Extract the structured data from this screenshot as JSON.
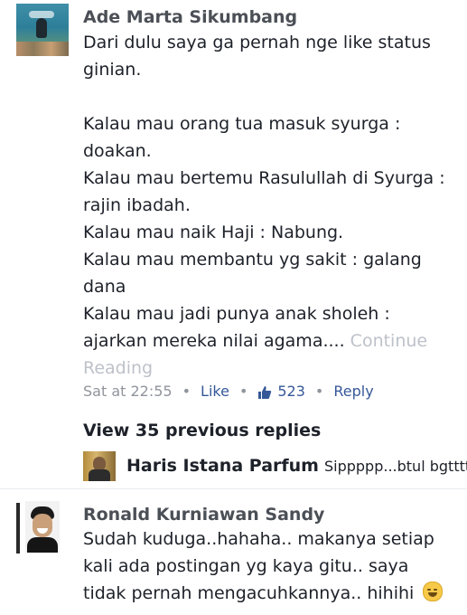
{
  "comment1": {
    "author": "Ade Marta Sikumbang",
    "lines": [
      "Dari dulu saya ga pernah nge like status",
      "ginian.",
      "",
      "Kalau mau orang tua masuk syurga :",
      "doakan.",
      "Kalau mau bertemu Rasulullah di Syurga :",
      "rajin ibadah.",
      "Kalau mau naik Haji : Nabung.",
      "Kalau mau membantu yg sakit : galang",
      "dana",
      "Kalau mau jadi punya anak sholeh :"
    ],
    "last_line": "ajarkan mereka nilai agama....",
    "continue_1": "Continue",
    "continue_2": "Reading",
    "time": "Sat at 22:55",
    "like_label": "Like",
    "like_count": "523",
    "reply_label": "Reply",
    "separator": "•"
  },
  "replies": {
    "view_previous": "View 35 previous replies",
    "latest_author": "Haris Istana Parfum",
    "latest_snippet": "Sippppp...btul bgtttt..."
  },
  "comment2": {
    "author": "Ronald Kurniawan Sandy",
    "lines": [
      "Sudah kuduga..hahaha.. makanya setiap",
      "kali ada postingan yg kaya gitu.. saya"
    ],
    "last_line": "tidak pernah mengacuhkannya..  hihihi",
    "emoji": "laughing-face-emoji"
  },
  "colors": {
    "link": "#365899",
    "text": "#1d2129",
    "meta": "#90949c",
    "muted": "#bdc1c9"
  }
}
